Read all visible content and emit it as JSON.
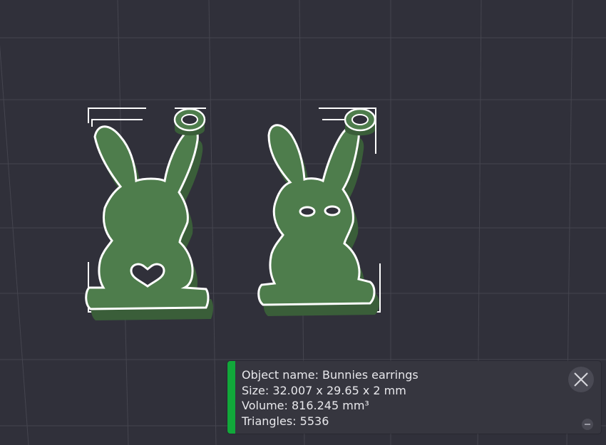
{
  "scene": {
    "background_color": "#30303a",
    "grid_color": "#45454f",
    "model_color": "#4e7d4c",
    "model_shadow_color": "#3a5e39",
    "outline_color": "#ffffff"
  },
  "info_panel": {
    "accent_color": "#11a83a",
    "object_name_line": "Object name: Bunnies earrings",
    "size_line": "Size: 32.007 x 29.65 x 2 mm",
    "volume_line": "Volume: 816.245 mm³",
    "triangles_line": "Triangles: 5536",
    "close_icon": "close-icon",
    "minimize_icon": "minimize-icon"
  }
}
